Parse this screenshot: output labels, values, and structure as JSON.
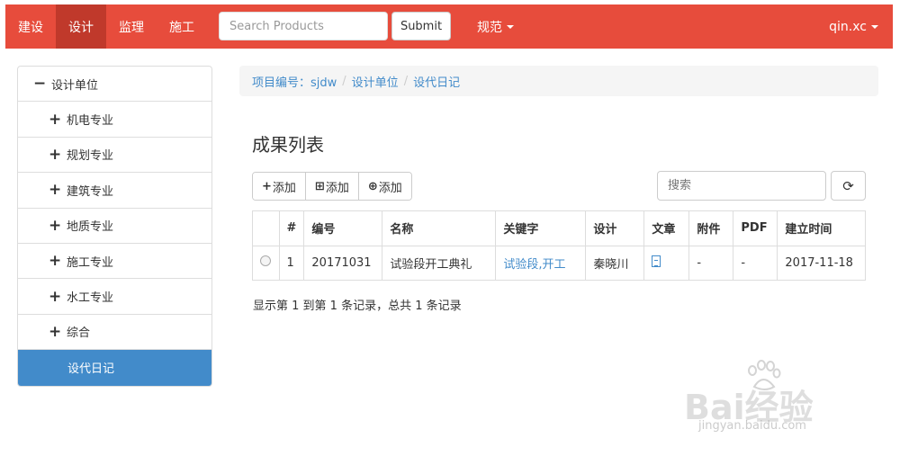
{
  "navbar": {
    "items": [
      "建设",
      "设计",
      "监理",
      "施工"
    ],
    "active_index": 1,
    "search_placeholder": "Search Products",
    "submit_label": "Submit",
    "dropdown_label": "规范",
    "user_label": "qin.xc",
    "color": "#e74c3c"
  },
  "sidebar": {
    "top_sign": "−",
    "top_label": "设计单位",
    "items": [
      {
        "sign": "+",
        "label": "机电专业"
      },
      {
        "sign": "+",
        "label": "规划专业"
      },
      {
        "sign": "+",
        "label": "建筑专业"
      },
      {
        "sign": "+",
        "label": "地质专业"
      },
      {
        "sign": "+",
        "label": "施工专业"
      },
      {
        "sign": "+",
        "label": "水工专业"
      },
      {
        "sign": "+",
        "label": "综合"
      }
    ],
    "active_label": "设代日记"
  },
  "breadcrumb": [
    "项目编号：sjdw",
    "设计单位",
    "设代日记"
  ],
  "page_title": "成果列表",
  "toolbar": {
    "buttons": [
      {
        "icon": "plus-icon",
        "glyph": "+",
        "label": "添加"
      },
      {
        "icon": "plus-square-outline-icon",
        "glyph": "⊞",
        "label": "添加"
      },
      {
        "icon": "plus-square-icon",
        "glyph": "⊕",
        "label": "添加"
      }
    ],
    "search_placeholder": "搜索",
    "refresh_icon": "refresh-icon"
  },
  "table": {
    "headers": [
      "",
      "#",
      "编号",
      "名称",
      "关键字",
      "设计",
      "文章",
      "附件",
      "PDF",
      "建立时间"
    ],
    "rows": [
      {
        "index": "1",
        "code": "20171031",
        "name": "试验段开工典礼",
        "keywords": "试验段,开工",
        "designer": "秦晓川",
        "attachment": "-",
        "pdf": "-",
        "created": "2017-11-18"
      }
    ]
  },
  "pager_info": "显示第 1 到第 1 条记录，总共 1 条记录",
  "watermark": {
    "text": "Bai经验",
    "sub": "jingyan.baidu.com"
  }
}
